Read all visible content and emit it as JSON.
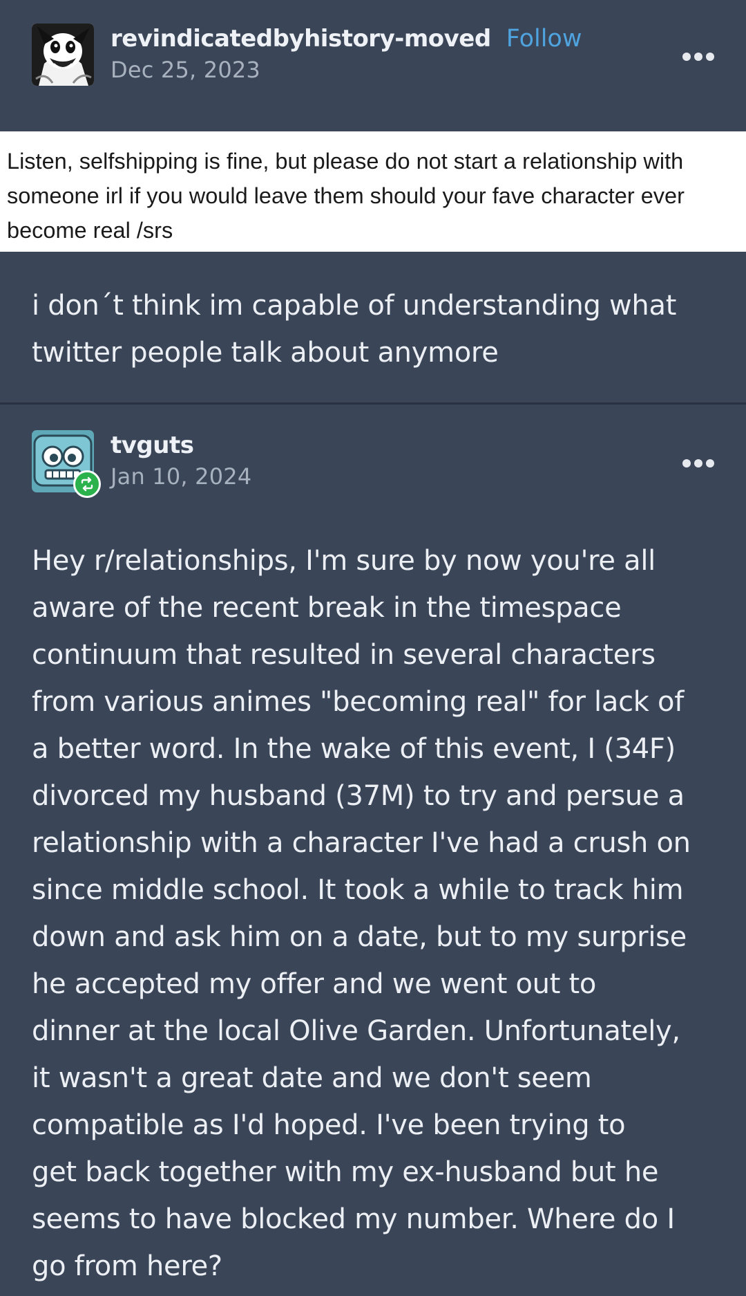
{
  "posts": [
    {
      "username": "revindicatedbyhistory-moved",
      "follow_label": "Follow",
      "date": "Dec 25, 2023",
      "tweet_lines": [
        "Listen, selfshipping is fine, but please do not start a relationship with",
        "someone irl if you would leave them should your fave character ever",
        "become real /srs"
      ],
      "body_lines": [
        "i don´t think im capable of understanding what",
        "twitter people talk about anymore"
      ]
    },
    {
      "username": "tvguts",
      "date": "Jan 10, 2024",
      "body_lines": [
        "Hey r/relationships, I'm sure by now you're all",
        "aware of the recent break in the timespace",
        "continuum that resulted in several characters",
        "from various animes \"becoming real\" for lack of",
        "a better word. In the wake of this event, I (34F)",
        "divorced my husband (37M) to try and persue a",
        "relationship with a character I've had a crush on",
        "since middle school. It took a while to track him",
        "down and ask him on a date, but to my surprise",
        "he accepted my offer and we went out to",
        "dinner at the local Olive Garden. Unfortunately,",
        "it wasn't a great date and we don't seem",
        "compatible as I'd hoped. I've been trying to",
        "get back together with my ex-husband but he",
        "seems to have blocked my number. Where do I",
        "go from here?"
      ]
    }
  ],
  "icons": {
    "more": "more-options-icon",
    "reblog": "reblog-icon"
  },
  "colors": {
    "background": "#3a4558",
    "follow": "#4fa3de",
    "reblog_badge": "#2bb24c"
  }
}
